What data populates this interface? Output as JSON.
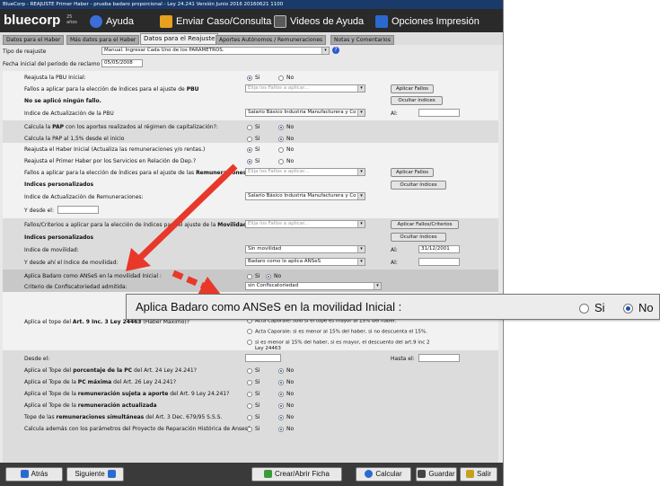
{
  "window_title": "BlueCorp - REAJUSTE Primer Haber - prueba badaro proporcional - Ley 24.241     Versión Junio 2016 20160621 1100",
  "header": {
    "logo": "bluecorp",
    "badge_line1": "25",
    "badge_line2": "años",
    "menu": [
      {
        "label": "Ayuda",
        "icon": "help-icon"
      },
      {
        "label": "Enviar Caso/Consulta",
        "icon": "mail-icon"
      },
      {
        "label": "Videos de Ayuda",
        "icon": "video-icon"
      },
      {
        "label": "Opciones Impresión",
        "icon": "printer-icon"
      }
    ]
  },
  "tabs": [
    {
      "label": "Datos para el Haber",
      "active": false
    },
    {
      "label": "Más datos para el Haber",
      "active": false
    },
    {
      "label": "Datos para el Reajuste",
      "active": true
    },
    {
      "label": "Aportes Autónomos / Remuneraciones",
      "active": false
    },
    {
      "label": "Notas y Comentarios",
      "active": false
    }
  ],
  "form": {
    "tipo_label": "Tipo de reajuste",
    "tipo_value": "Manual. Ingresar Cada Uno de los PARÁMETROS.",
    "fecha_label": "Fecha inicial del período de reclamo",
    "fecha_value": "05/05/2008",
    "reajusta_pbu_label": "Reajusta la PBU Inicial:",
    "si": "Si",
    "no": "No",
    "fallos_pbu_label_a": "Fallos a aplicar para la elección de índices para el ajuste de",
    "fallos_pbu_label_b": "PBU",
    "fallos_placeholder": "Elija los Fallos a aplicar...",
    "aplicar_fallos": "Aplicar Fallos",
    "no_fallo": "No se aplicó ningún fallo.",
    "ocultar_indices": "Ocultar índices",
    "indice_pbu_label": "Indice de Actualización de la PBU",
    "indice_pbu_value": "Salario Básico Industria Manufacturera y Co",
    "al": "Al:",
    "pap_label_a": "Calcula la",
    "pap_label_b": "PAP",
    "pap_label_c": "con los aportes realizados al régimen de capitalización?:",
    "pap15_label": "Calcula la PAP al 1,5% desde el inicio",
    "reajusta_haber_label": "Reajusta el Haber Inicial (Actualiza las remuneraciones y/o rentas.)",
    "reajusta_primer_label": "Reajusta el Primer Haber por los Servicios en Relación de Dep.?",
    "fallos_rem_label_a": "Fallos a aplicar para la elección de índices para el ajuste de las",
    "fallos_rem_label_b": "Remuneraciones",
    "indices_personalizados": "Indices personalizados",
    "ocultar_indices_2": "Ocultar índices",
    "indice_rem_label": "Indice de Actualización de Remuneraciones:",
    "indice_rem_value": "Salario Básico Industria Manufacturera y Co",
    "desde_label": "Y desde el:",
    "fallos_mov_label_a": "Fallos/Criterios a aplicar para la elección de índices para el ajuste de la",
    "fallos_mov_label_b": "Movilidad",
    "fallos_mov_placeholder": "Elija los Fallos a aplicar...",
    "aplicar_fallos_criterios": "Aplicar Fallos/Criterios",
    "indices_personalizados_2": "Indices personalizados",
    "ocultar_indices_3": "Ocultar índices",
    "indice_mov_label": "Indice de movilidad:",
    "indice_mov_value": "Sin movilidad",
    "al_value": "31/12/2001",
    "desde_ahi_label": "Y desde ahí el índice de movilidad:",
    "desde_ahi_value": "Badaro como lo aplica ANSeS",
    "badaro_label": "Aplica Badaro como ANSeS en la movilidad Inicial :",
    "criterio_label": "Criterio de Confiscatoriedad admitida:",
    "criterio_value": "sin Confiscatoriedad",
    "tope_label_a": "Aplica el tope del",
    "tope_label_b": "Art. 9 Inc. 3 Ley 24463",
    "tope_label_c": "(Haber Máximo)?",
    "tope_opt1": "Acta Caporale: solo si el tope es mayor al 15% del haber.",
    "tope_opt2": "Acta Caporale: si es menor al 15% del haber, si no descuenta el 15%.",
    "tope_opt3_a": "si es menor al 15% del haber, si es mayor, el descuento del art.9 inc 2",
    "tope_opt3_b": "Ley 24463",
    "desde_el": "Desde el:",
    "hasta_el": "Hasta el:",
    "tope_pc_a": "Aplica el Tope del",
    "tope_pc_b": "porcentaje de la PC",
    "tope_pc_c": "del Art. 24 Ley 24.241?",
    "tope_pcmax_a": "Aplica el Tope de la",
    "tope_pcmax_b": "PC máxima",
    "tope_pcmax_c": "del Art. 26 Ley 24.241?",
    "tope_rem_a": "Aplica el Tope de la",
    "tope_rem_b": "remuneración sujeta a aporte",
    "tope_rem_c": "del Art. 9 Ley 24.241?",
    "tope_act_a": "Aplica el Tope de la",
    "tope_act_b": "remuneración actualizada",
    "tope_sim_a": "Tope de las",
    "tope_sim_b": "remuneraciones simultáneas",
    "tope_sim_c": "del Art. 3 Dec. 679/95 S.S.S.",
    "calcula_label": "Calcula además con los parámetros del Proyecto de Reparación Histórica de Anses?:"
  },
  "zoom": {
    "label": "Aplica Badaro como ANSeS en la movilidad Inicial :",
    "si": "Si",
    "no": "No",
    "selected": "No"
  },
  "footer": {
    "atras": "Atrás",
    "siguiente": "Siguiente",
    "crear": "Crear/Abrir Ficha",
    "calcular": "Calcular",
    "guardar": "Guardar",
    "salir": "Salir"
  },
  "colors": {
    "arrow": "#e8382a",
    "header_bg": "#2a2a2a",
    "radio_dot": "#1a4fb0"
  }
}
